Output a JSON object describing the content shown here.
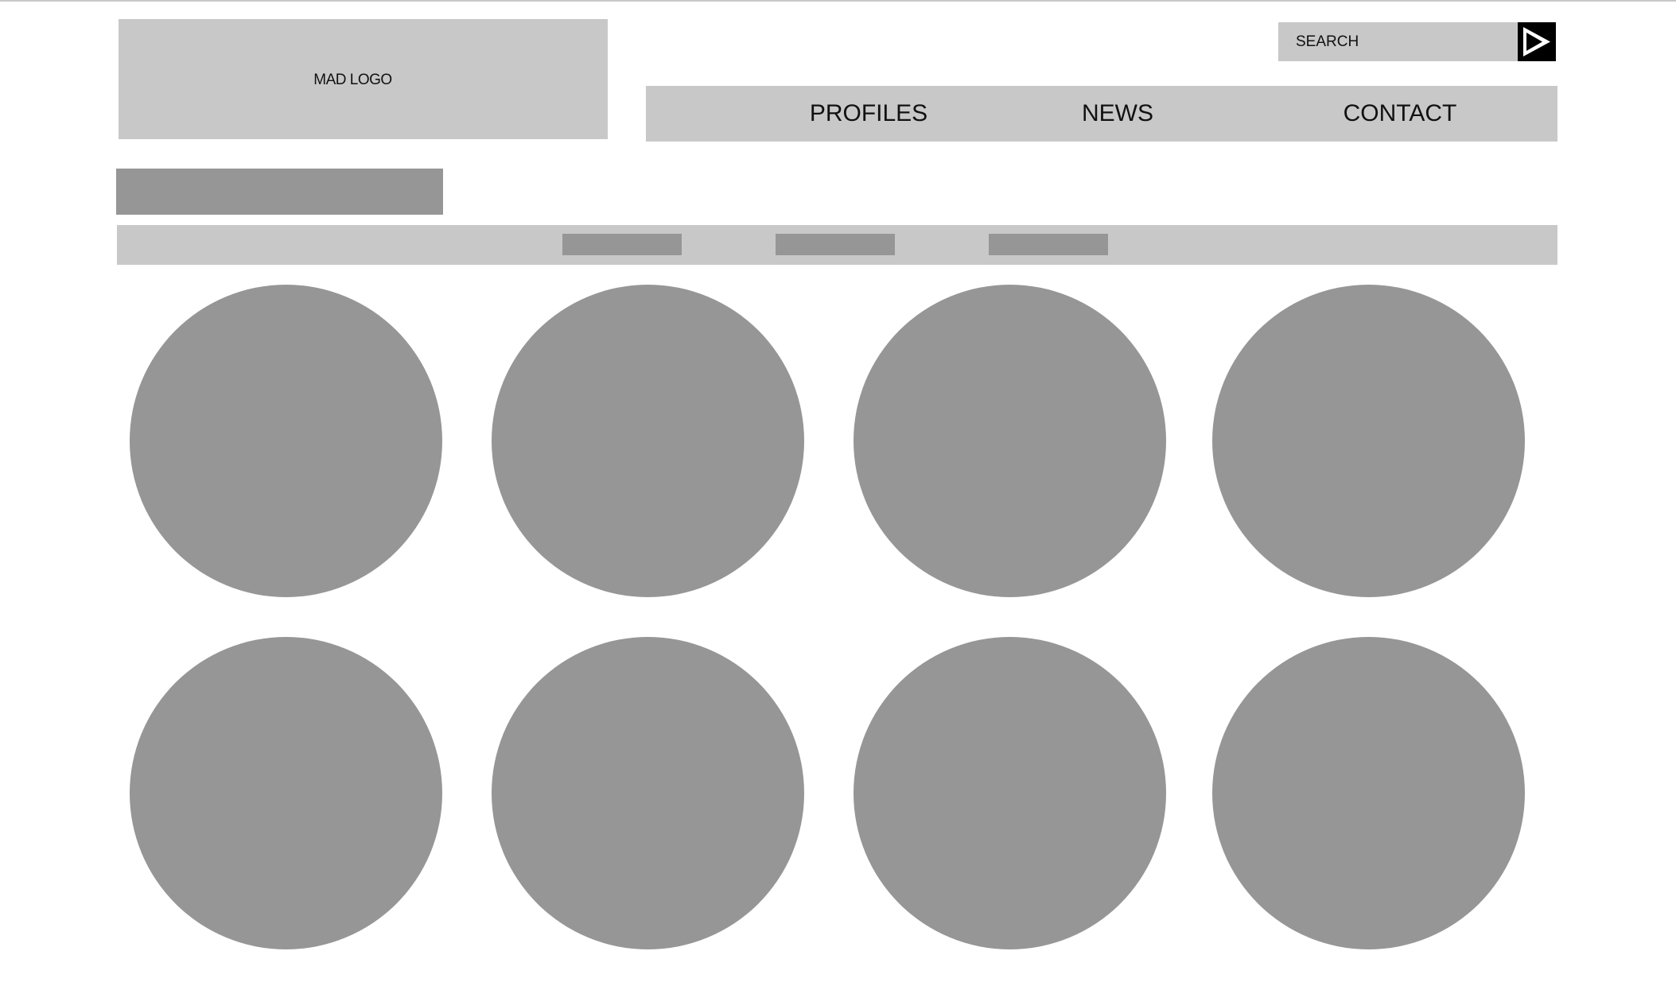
{
  "header": {
    "logo_text": "MAD LOGO",
    "search": {
      "placeholder": "SEARCH",
      "button_icon": "play-triangle-icon"
    }
  },
  "nav": {
    "items": [
      {
        "label": "PROFILES"
      },
      {
        "label": "NEWS"
      },
      {
        "label": "CONTACT"
      }
    ]
  },
  "profiles_grid": {
    "count": 8,
    "rows": 2,
    "columns": 4
  },
  "colors": {
    "light_block": "#c8c8c8",
    "dark_block": "#969696",
    "search_button": "#000000",
    "background": "#ffffff",
    "text": "#111111"
  }
}
